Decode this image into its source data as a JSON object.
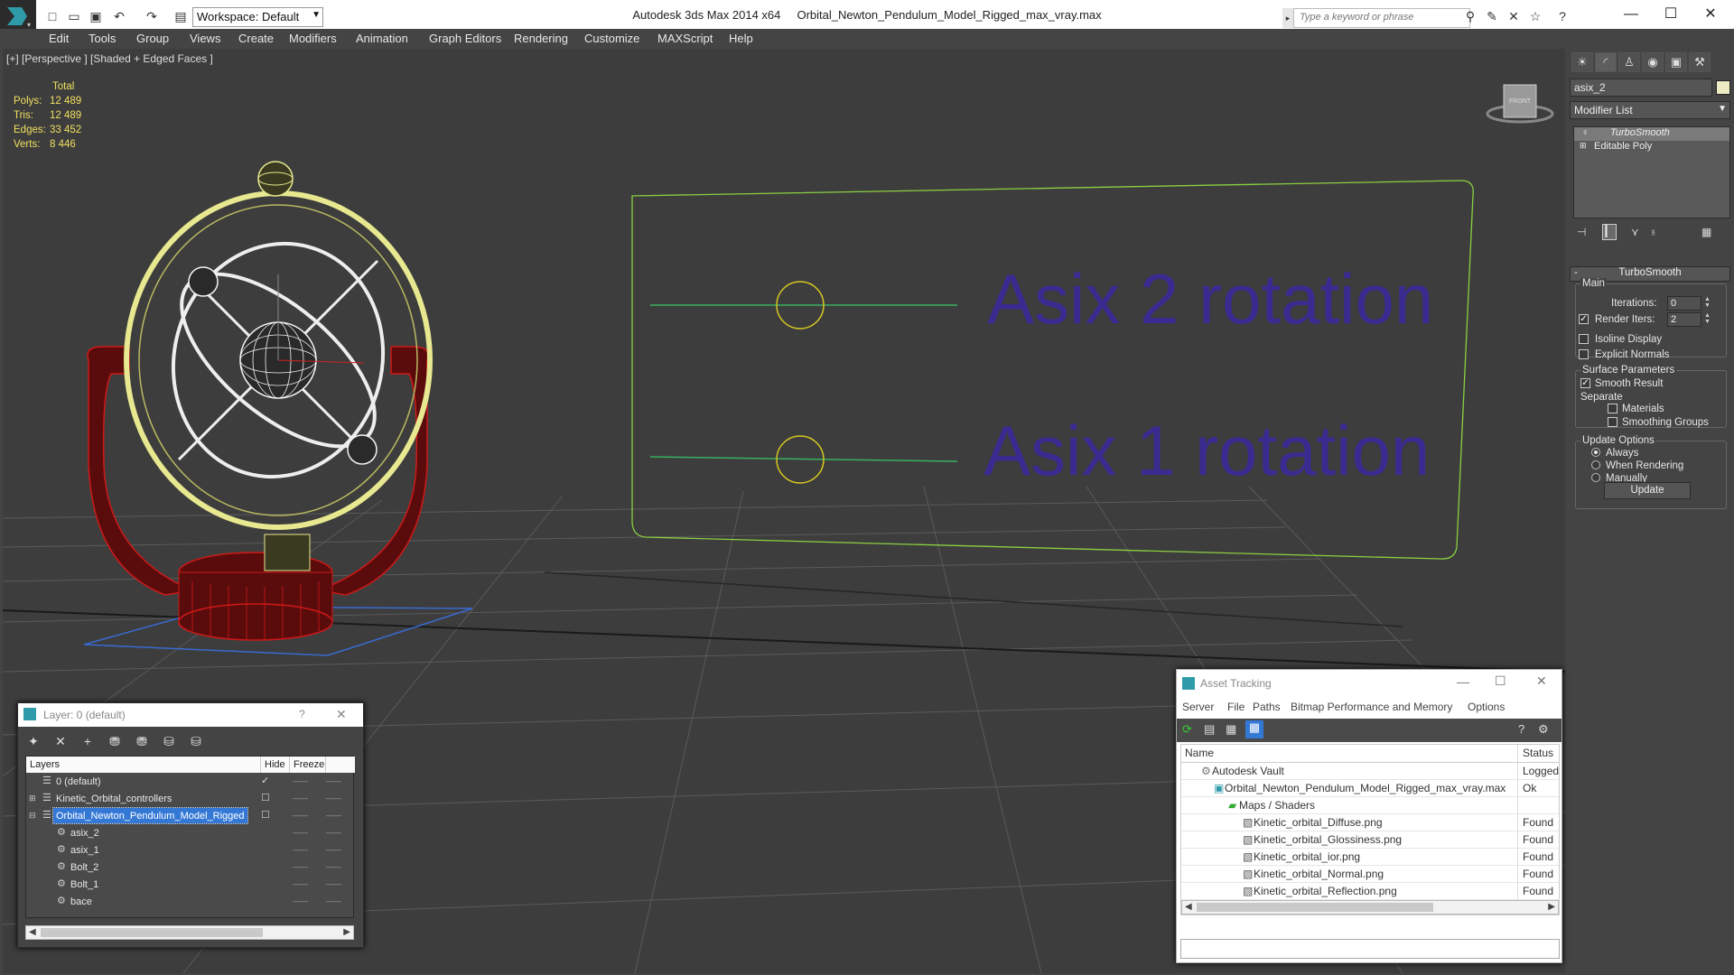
{
  "app": {
    "title": "Autodesk 3ds Max  2014 x64",
    "file": "Orbital_Newton_Pendulum_Model_Rigged_max_vray.max",
    "workspace": "Workspace: Default",
    "search_placeholder": "Type a keyword or phrase"
  },
  "menu": [
    "Edit",
    "Tools",
    "Group",
    "Views",
    "Create",
    "Modifiers",
    "Animation",
    "Graph Editors",
    "Rendering",
    "Customize",
    "MAXScript",
    "Help"
  ],
  "viewport": {
    "label": "[+] [Perspective ] [Shaded + Edged Faces ]",
    "stats_header": "Total",
    "stats": [
      {
        "k": "Polys:",
        "v": "12 489"
      },
      {
        "k": "Tris:",
        "v": "12 489"
      },
      {
        "k": "Edges:",
        "v": "33 452"
      },
      {
        "k": "Verts:",
        "v": "8 446"
      }
    ],
    "rig_labels": [
      "Asix 2 rotation",
      "Asix 1 rotation"
    ],
    "viewcube_label": "FRONT"
  },
  "command_panel": {
    "object_name": "asix_2",
    "modifier_list": "Modifier List",
    "stack": [
      "TurboSmooth",
      "Editable Poly"
    ],
    "rollout_title": "TurboSmooth",
    "main_label": "Main",
    "iterations_label": "Iterations:",
    "iterations_value": "0",
    "render_iters_label": "Render Iters:",
    "render_iters_value": "2",
    "isoline": "Isoline Display",
    "explicit": "Explicit Normals",
    "surface_params": "Surface Parameters",
    "smooth_result": "Smooth Result",
    "separate": "Separate",
    "materials": "Materials",
    "smoothing_groups": "Smoothing Groups",
    "update_options": "Update Options",
    "always": "Always",
    "when_rendering": "When Rendering",
    "manually": "Manually",
    "update_button": "Update"
  },
  "layer_dialog": {
    "title": "Layer: 0 (default)",
    "help": "?",
    "columns": [
      "Layers",
      "Hide",
      "Freeze"
    ],
    "rows": [
      {
        "name": "0 (default)",
        "indent": 1
      },
      {
        "name": "Kinetic_Orbital_controllers",
        "indent": 0
      },
      {
        "name": "Orbital_Newton_Pendulum_Model_Rigged",
        "indent": 0
      },
      {
        "name": "asix_2",
        "indent": 2
      },
      {
        "name": "asix_1",
        "indent": 2
      },
      {
        "name": "Bolt_2",
        "indent": 2
      },
      {
        "name": "Bolt_1",
        "indent": 2
      },
      {
        "name": "bace",
        "indent": 2
      }
    ],
    "selected_row": "Orbital_Newton_Pendulum_Model_Rigged"
  },
  "asset_dialog": {
    "title": "Asset Tracking",
    "menu": [
      "Server",
      "File",
      "Paths",
      "Bitmap Performance and Memory",
      "Options"
    ],
    "columns": [
      "Name",
      "Status"
    ],
    "rows": [
      {
        "name": "Autodesk Vault",
        "status": "Logged O",
        "indent": 1
      },
      {
        "name": "Orbital_Newton_Pendulum_Model_Rigged_max_vray.max",
        "status": "Ok",
        "indent": 2
      },
      {
        "name": "Maps / Shaders",
        "status": "",
        "indent": 3
      },
      {
        "name": "Kinetic_orbital_Diffuse.png",
        "status": "Found",
        "indent": 4
      },
      {
        "name": "Kinetic_orbital_Glossiness.png",
        "status": "Found",
        "indent": 4
      },
      {
        "name": "Kinetic_orbital_ior.png",
        "status": "Found",
        "indent": 4
      },
      {
        "name": "Kinetic_orbital_Normal.png",
        "status": "Found",
        "indent": 4
      },
      {
        "name": "Kinetic_orbital_Reflection.png",
        "status": "Found",
        "indent": 4
      }
    ]
  },
  "colors": {
    "selection": "#3478d6",
    "stats": "#f0e060",
    "rig_text": "#3a2a9a",
    "wire_yellow": "#e8e890",
    "wire_red": "#d01818"
  }
}
